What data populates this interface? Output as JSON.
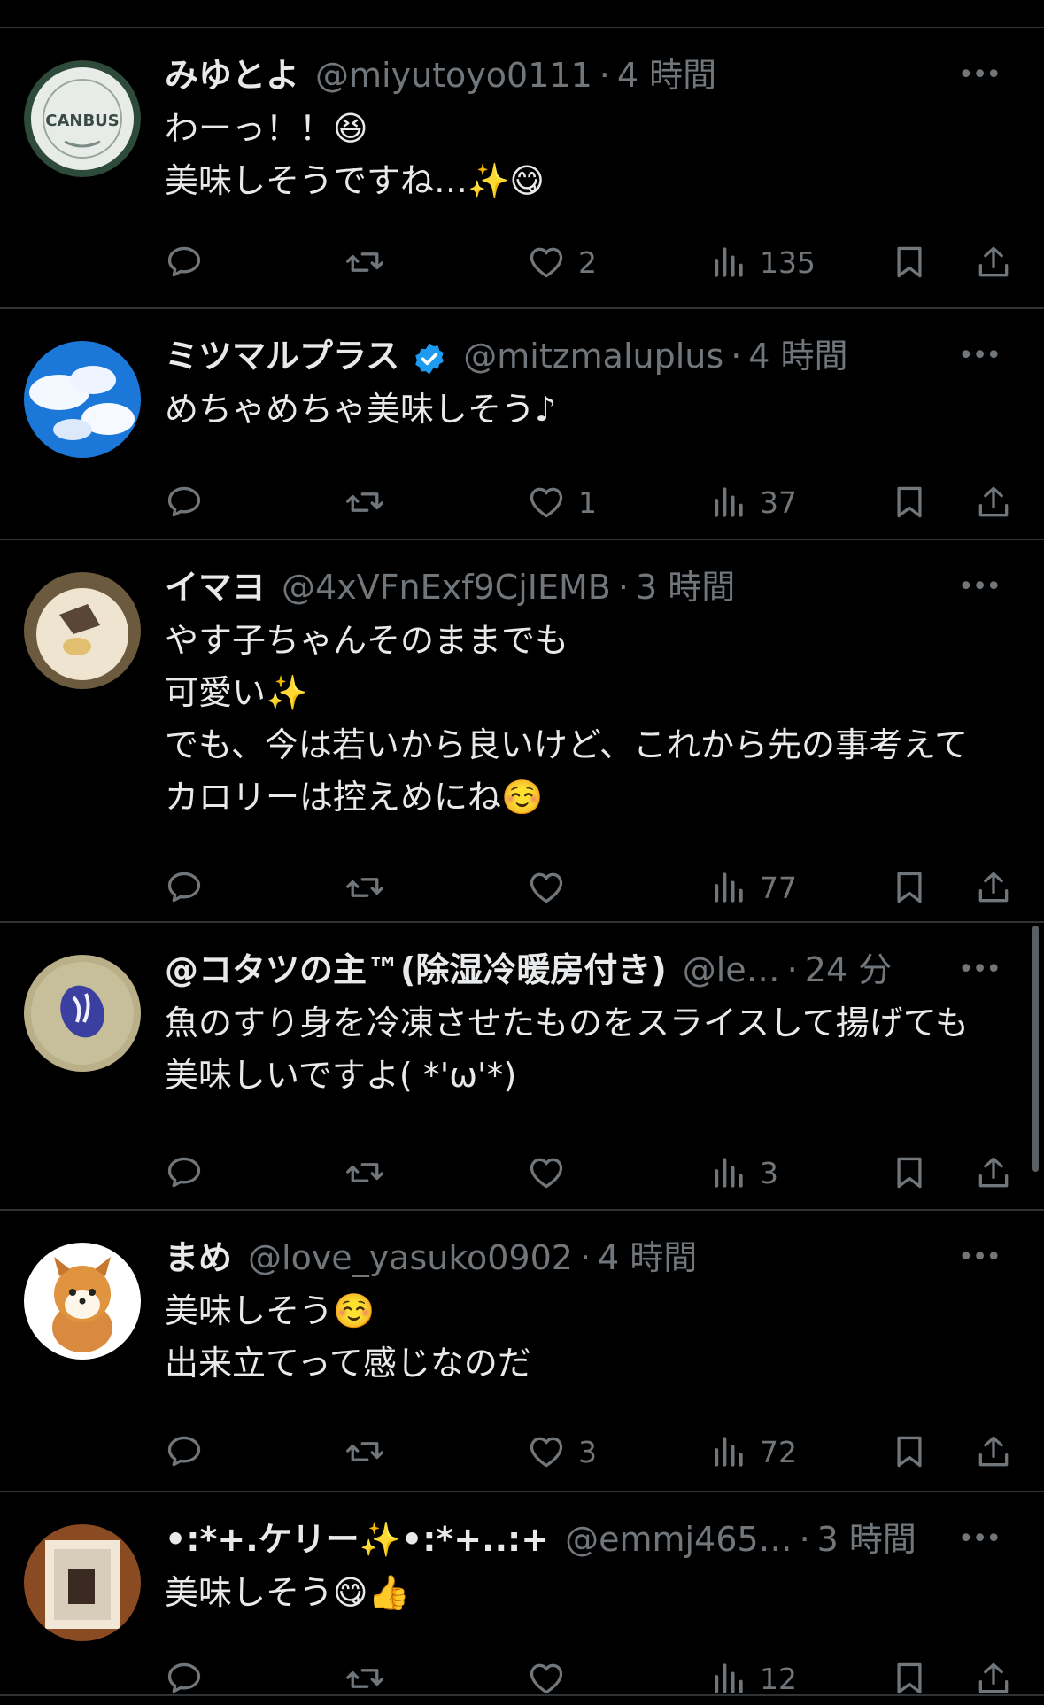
{
  "colors": {
    "background": "#000000",
    "text": "#e7e9ea",
    "muted": "#71767b",
    "divider": "#2f3336",
    "verified": "#1d9bf0"
  },
  "icons": {
    "reply": "reply-icon",
    "retweet": "retweet-icon",
    "like": "heart-icon",
    "views": "views-icon",
    "bookmark": "bookmark-icon",
    "share": "share-icon",
    "more": "more-icon"
  },
  "posts": [
    {
      "name": "みゆとよ",
      "handle": "@miyutoyo0111",
      "sep": "·",
      "time": "4 時間",
      "text": "わーっ！！😆\n美味しそうですね…✨😋",
      "likes": "2",
      "views": "135",
      "more": "•••",
      "avatar_text": "CANBUS"
    },
    {
      "name": "ミツマルプラス",
      "verified": true,
      "handle": "@mitzmaluplus",
      "sep": "·",
      "time": "4 時間",
      "text": "めちゃめちゃ美味しそう♪",
      "likes": "1",
      "views": "37",
      "more": "•••"
    },
    {
      "name": "イマヨ",
      "handle": "@4xVFnExf9CjIEMB",
      "sep": "·",
      "time": "3 時間",
      "text": "やす子ちゃんそのままでも\n可愛い✨\nでも、今は若いから良いけど、これから先の事考えてカロリーは控えめにね☺️",
      "likes": "",
      "views": "77",
      "more": "•••"
    },
    {
      "name": "@コタツの主™(除湿冷暖房付き)",
      "handle": "@le…",
      "sep": "·",
      "time": "24 分",
      "text": "魚のすり身を冷凍させたものをスライスして揚げても美味しいですよ( *'ω'*)",
      "likes": "",
      "views": "3",
      "more": "•••"
    },
    {
      "name": "まめ",
      "handle": "@love_yasuko0902",
      "sep": "·",
      "time": "4 時間",
      "text": "美味しそう☺️\n出来立てって感じなのだ",
      "likes": "3",
      "views": "72",
      "more": "•••"
    },
    {
      "name": "•:*+.ケリー✨•:*+..:+",
      "handle": "@emmj465…",
      "sep": "·",
      "time": "3 時間",
      "text": "美味しそう😋👍",
      "likes": "",
      "views": "12",
      "more": "•••"
    }
  ]
}
